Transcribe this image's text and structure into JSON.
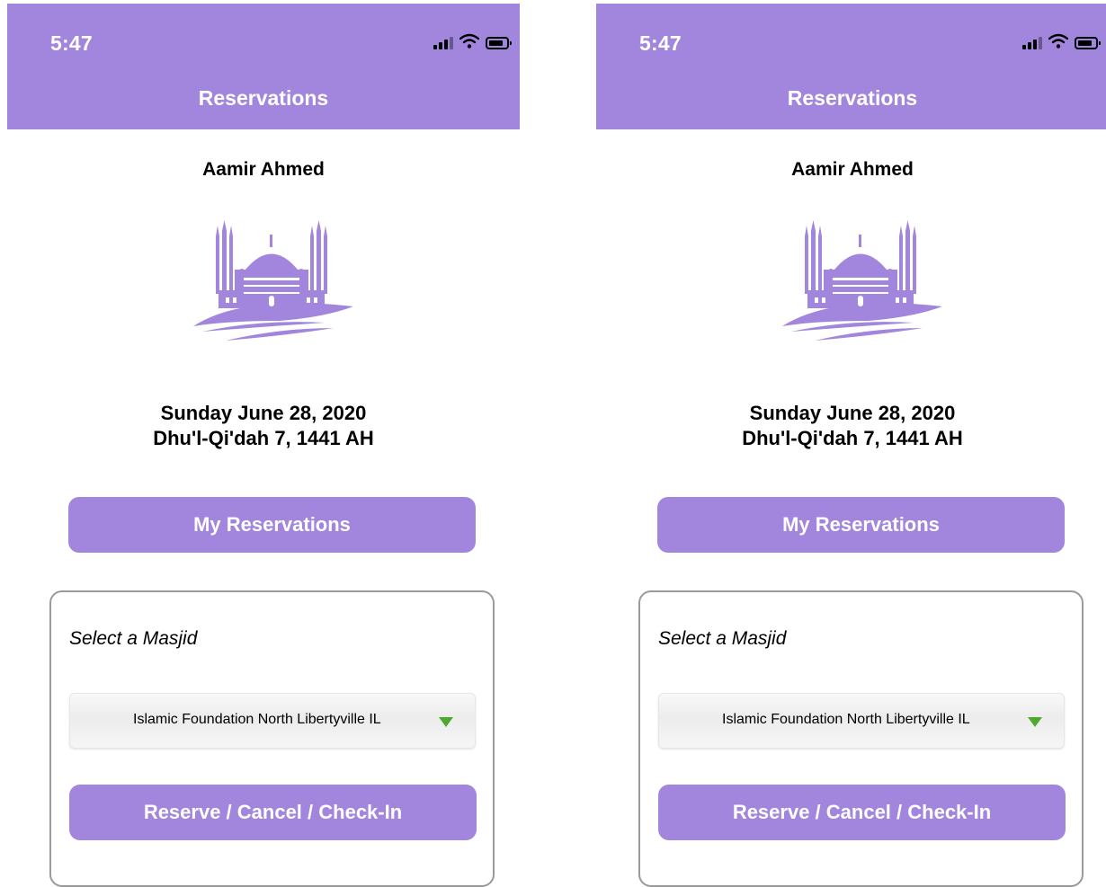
{
  "colors": {
    "accent": "#a286dd",
    "dropdown_arrow": "#4fa82f"
  },
  "screens": [
    {
      "status_bar": {
        "time": "5:47"
      },
      "header": {
        "title": "Reservations"
      },
      "user": {
        "name": "Aamir Ahmed"
      },
      "logo": {
        "icon": "mosque-logo-icon"
      },
      "date": {
        "gregorian": "Sunday June 28, 2020",
        "hijri": "Dhu'l-Qi'dah 7, 1441 AH"
      },
      "my_reservations_label": "My Reservations",
      "panel": {
        "select_label": "Select a Masjid",
        "selected_masjid": "Islamic Foundation North Libertyville IL",
        "action_label": "Reserve / Cancel / Check-In"
      }
    },
    {
      "status_bar": {
        "time": "5:47"
      },
      "header": {
        "title": "Reservations"
      },
      "user": {
        "name": "Aamir Ahmed"
      },
      "logo": {
        "icon": "mosque-logo-icon"
      },
      "date": {
        "gregorian": "Sunday June 28, 2020",
        "hijri": "Dhu'l-Qi'dah 7, 1441 AH"
      },
      "my_reservations_label": "My Reservations",
      "panel": {
        "select_label": "Select a Masjid",
        "selected_masjid": "Islamic Foundation North Libertyville IL",
        "action_label": "Reserve / Cancel / Check-In"
      }
    }
  ]
}
